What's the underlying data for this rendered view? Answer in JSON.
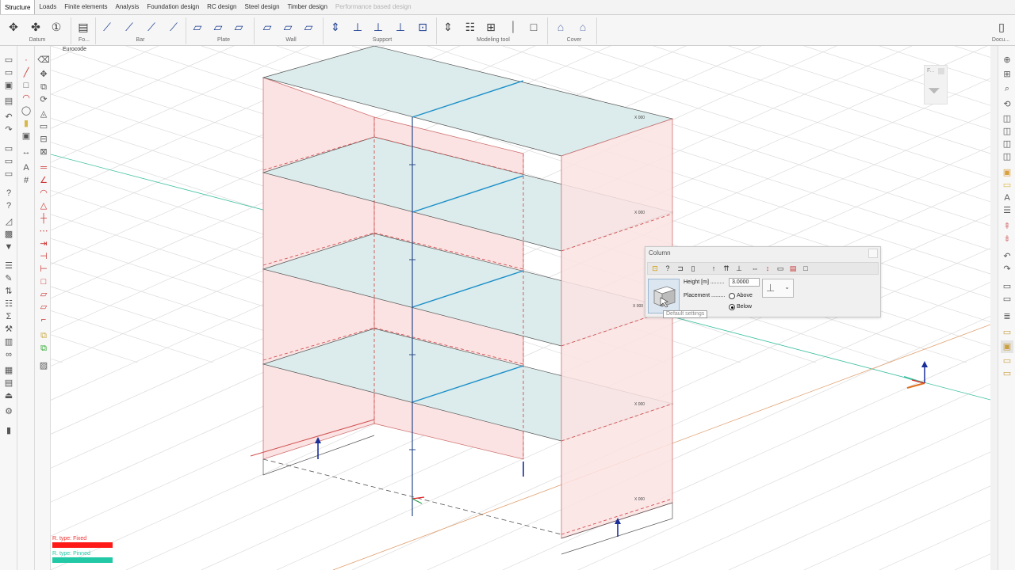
{
  "menu": {
    "tabs": [
      {
        "label": "Structure",
        "state": "active"
      },
      {
        "label": "Loads",
        "state": "normal"
      },
      {
        "label": "Finite elements",
        "state": "normal"
      },
      {
        "label": "Analysis",
        "state": "normal"
      },
      {
        "label": "Foundation design",
        "state": "normal"
      },
      {
        "label": "RC design",
        "state": "normal"
      },
      {
        "label": "Steel design",
        "state": "normal"
      },
      {
        "label": "Timber design",
        "state": "normal"
      },
      {
        "label": "Performance based design",
        "state": "disabled"
      }
    ]
  },
  "ribbon": {
    "groups": [
      "Datum",
      "Fo...",
      "Bar",
      "Plate",
      "Wall",
      "Support",
      "Modeling tool",
      "Cover",
      "Docu..."
    ]
  },
  "viewport": {
    "code_label": "Eurocode",
    "legend": [
      {
        "label": "R. type: Fixed",
        "color": "#ff1a1a"
      },
      {
        "label": "R. type: Pinned",
        "color": "#23c9a6"
      }
    ],
    "wall_labels": [
      "X 000",
      "X 000",
      "X 000",
      "X 000",
      "X 000"
    ]
  },
  "filter_panel": {
    "label": "F..."
  },
  "column_dialog": {
    "title": "Column",
    "height_label": "Height [m] .........",
    "height_value": "3.0000",
    "placement_label": "Placement .........",
    "options": [
      {
        "label": "Above",
        "selected": false
      },
      {
        "label": "Below",
        "selected": true
      }
    ],
    "tooltip": "Default settings"
  },
  "colors": {
    "slab_fill": "#dcebeb",
    "wall_fill": "#fbe3e3",
    "wall_stroke": "#d07070",
    "beam": "#1a8fc9",
    "grid": "#d6d6d6"
  }
}
